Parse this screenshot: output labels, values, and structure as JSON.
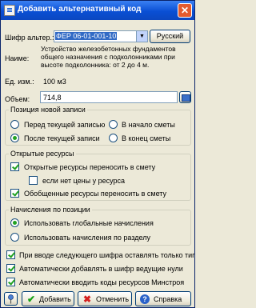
{
  "window": {
    "title": "Добавить альтернативный код"
  },
  "form": {
    "cipher_label": "Шифр альтер.:",
    "cipher_value": "ФЕР 06-01-001-10",
    "language_button": "Русский",
    "name_label": "Наиме:",
    "name_text": "Устройство железобетонных фундаментов общего назначения с подколонниками при высоте подколонника: от 2 до 4 м.",
    "unit_label": "Ед. изм.:",
    "unit_value": "100 м3",
    "volume_label": "Объем:",
    "volume_value": "714,8"
  },
  "position_group": {
    "title": "Позиция новой записи",
    "options": [
      {
        "label": "Перед текущей записью",
        "selected": false
      },
      {
        "label": "В начало сметы",
        "selected": false
      },
      {
        "label": "После текущей записи",
        "selected": true
      },
      {
        "label": "В конец сметы",
        "selected": false
      }
    ]
  },
  "resources_group": {
    "title": "Открытые ресурсы",
    "options": [
      {
        "label": "Открытые ресурсы переносить в смету",
        "checked": true
      },
      {
        "label": "если нет цены у ресурса",
        "checked": false
      },
      {
        "label": "Обобщенные ресурсы переносить в смету",
        "checked": true
      }
    ]
  },
  "charges_group": {
    "title": "Начисления по позиции",
    "options": [
      {
        "label": "Использовать глобальные начисления",
        "selected": true
      },
      {
        "label": "Использовать начисления по разделу",
        "selected": false
      }
    ]
  },
  "options": [
    {
      "label": "При вводе следующего шифра оставлять только тип",
      "checked": true
    },
    {
      "label": "Автоматически добавлять в шифр ведущие нули",
      "checked": true
    },
    {
      "label": "Автоматически вводить коды ресурсов Минстроя",
      "checked": true
    }
  ],
  "buttons": {
    "add": "Добавить",
    "cancel": "Отменить",
    "help": "Справка"
  },
  "colors": {
    "title_bar": "#0a4fd4",
    "check_green": "#21a121",
    "window_bg": "#ece9d8"
  },
  "icons": [
    "dialog-icon",
    "close-icon",
    "dropdown-arrow-icon",
    "calculator-icon",
    "pin-icon",
    "checkmark-icon",
    "x-icon",
    "question-icon"
  ]
}
